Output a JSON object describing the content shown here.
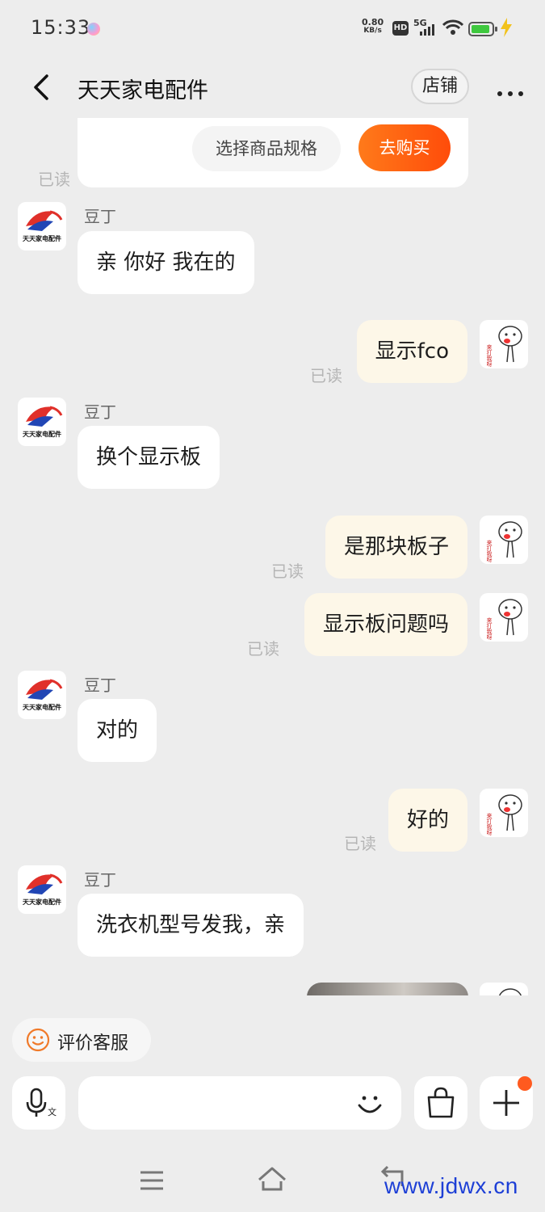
{
  "status_bar": {
    "time": "15:33",
    "net_speed_value": "0.80",
    "net_speed_unit": "KB/s",
    "hd": "HD",
    "network": "5G"
  },
  "header": {
    "title": "天天家电配件",
    "shop_label": "店铺"
  },
  "product_card": {
    "spec_label": "选择商品规格",
    "buy_label": "去购买",
    "read": "已读"
  },
  "shop_avatar_text": "天天家电配件",
  "me_avatar_text": "来打我呀",
  "messages": [
    {
      "from": "shop",
      "nick": "豆丁",
      "text": "亲  你好  我在的"
    },
    {
      "from": "me",
      "text": "显示fco",
      "read": "已读"
    },
    {
      "from": "shop",
      "nick": "豆丁",
      "text": "换个显示板"
    },
    {
      "from": "me",
      "text": "是那块板子",
      "read": "已读"
    },
    {
      "from": "me",
      "text": "显示板问题吗",
      "read": "已读"
    },
    {
      "from": "shop",
      "nick": "豆丁",
      "text": "对的"
    },
    {
      "from": "me",
      "text": "好的",
      "read": "已读"
    },
    {
      "from": "shop",
      "nick": "豆丁",
      "text": "洗衣机型号发我，亲"
    }
  ],
  "bottom": {
    "rate_label": "评价客服",
    "input_placeholder": ""
  },
  "watermark": "www.jdwx.cn",
  "colors": {
    "accent": "#ff5a1f",
    "outgoing_bubble": "#fdf7e8",
    "incoming_bubble": "#ffffff",
    "background": "#ededed"
  }
}
